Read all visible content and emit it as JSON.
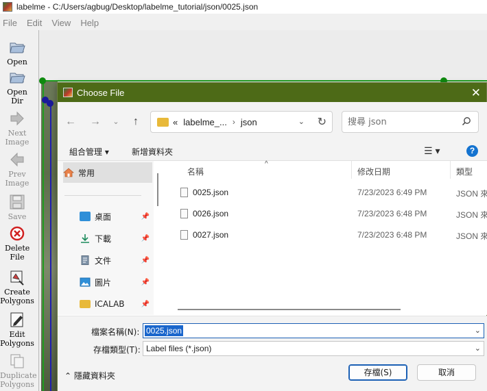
{
  "window": {
    "title": "labelme - C:/Users/agbug/Desktop/labelme_tutorial/json/0025.json"
  },
  "menu": [
    "File",
    "Edit",
    "View",
    "Help"
  ],
  "tools": [
    {
      "label": "Open",
      "icon": "open-folder-icon",
      "enabled": true
    },
    {
      "label": "Open Dir",
      "icon": "open-dir-icon",
      "enabled": true
    },
    {
      "label": "Next Image",
      "icon": "next-image-icon",
      "enabled": false
    },
    {
      "label": "Prev Image",
      "icon": "prev-image-icon",
      "enabled": false
    },
    {
      "label": "Save",
      "icon": "save-icon",
      "enabled": false
    },
    {
      "label": "Delete File",
      "icon": "delete-icon",
      "enabled": true
    },
    {
      "label": "Create Polygons",
      "icon": "create-polygon-icon",
      "enabled": true
    },
    {
      "label": "Edit Polygons",
      "icon": "edit-polygon-icon",
      "enabled": true
    },
    {
      "label": "Duplicate Polygons",
      "icon": "duplicate-icon",
      "enabled": false
    }
  ],
  "dialog": {
    "title": "Choose File",
    "address": {
      "prefix": "«",
      "crumbs": [
        "labelme_...",
        "json"
      ]
    },
    "search_placeholder": "搜尋 json",
    "commands": {
      "organize": "組合管理 ▾",
      "new_folder": "新增資料夾"
    },
    "nav": {
      "quick_access": "常用",
      "items": [
        {
          "label": "桌面",
          "icon": "desktop-icon"
        },
        {
          "label": "下載",
          "icon": "download-icon"
        },
        {
          "label": "文件",
          "icon": "documents-icon"
        },
        {
          "label": "圖片",
          "icon": "pictures-icon"
        },
        {
          "label": "ICALAB",
          "icon": "folder-icon"
        }
      ]
    },
    "columns": {
      "name": "名稱",
      "modified": "修改日期",
      "type": "類型"
    },
    "files": [
      {
        "name": "0025.json",
        "modified": "7/23/2023 6:49 PM",
        "type": "JSON 來"
      },
      {
        "name": "0026.json",
        "modified": "7/23/2023 6:48 PM",
        "type": "JSON 來"
      },
      {
        "name": "0027.json",
        "modified": "7/23/2023 6:48 PM",
        "type": "JSON 來"
      }
    ],
    "filename_label": "檔案名稱(N):",
    "filename_value": "0025.json",
    "filetype_label": "存檔類型(T):",
    "filetype_value": "Label files (*.json)",
    "hide_folders": "隱藏資料夾",
    "save_button": "存檔(S)",
    "cancel_button": "取消"
  },
  "colors": {
    "dialog_title": "#4d6a17",
    "accent": "#1a66cc"
  }
}
